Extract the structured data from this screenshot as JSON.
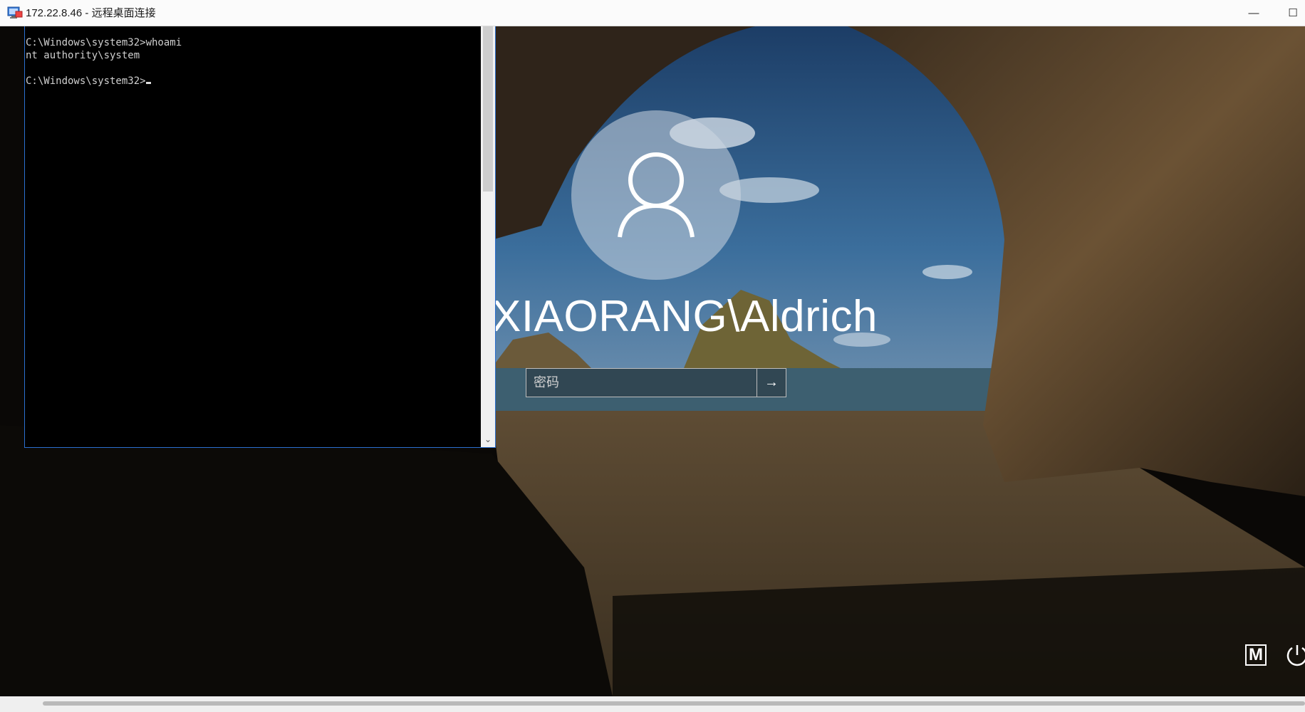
{
  "window": {
    "title": "172.22.8.46 - 远程桌面连接",
    "minimize_label": "—",
    "maximize_label": "☐"
  },
  "console": {
    "lines": "C:\\Windows\\system32>whoami\nnt authority\\system\n\nC:\\Windows\\system32>"
  },
  "login": {
    "username": "XIAORANG\\Aldrich",
    "password_placeholder": "密码",
    "submit_icon": "arrow-right-icon"
  },
  "tray": {
    "ease_of_access_label": "M",
    "power_icon": "power-icon"
  },
  "colors": {
    "console_border": "#2b6fcf",
    "sky": "#2f5f93"
  }
}
